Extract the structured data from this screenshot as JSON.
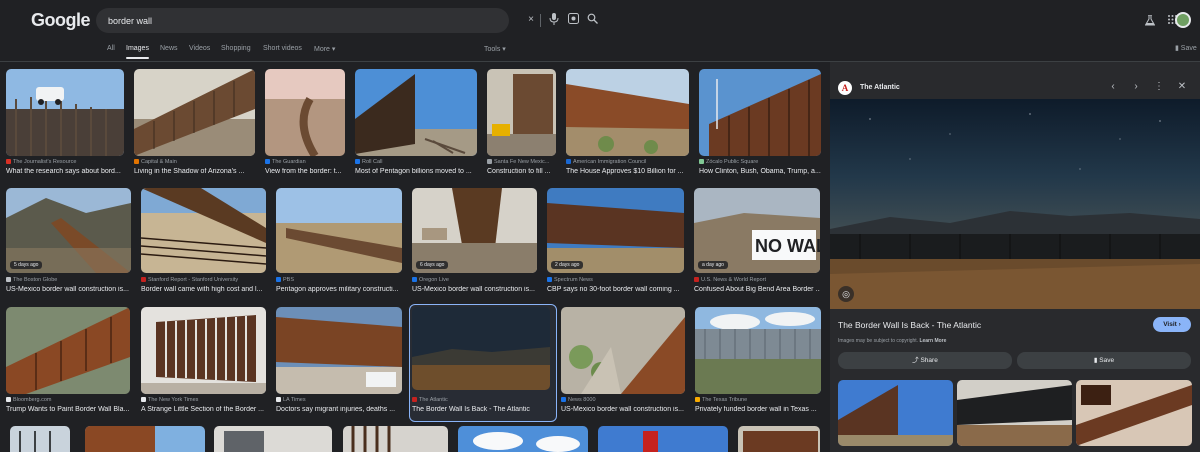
{
  "header": {
    "logo": "Google",
    "search_value": "border wall",
    "tabs": [
      "All",
      "Images",
      "News",
      "Videos",
      "Shopping",
      "Short videos",
      "More ▾",
      "Tools ▾"
    ],
    "save_label": "Save"
  },
  "icons": {
    "clear": "×",
    "mic": "🎤",
    "lens": "◎",
    "search": "⌕",
    "labs": "⚗",
    "apps": "⋮⋮",
    "bookmark": "▮"
  },
  "results": [
    {
      "source": "The Journalist's Resource",
      "title": "What the research says about bord...",
      "icon_color": "#d93025"
    },
    {
      "source": "Capital & Main",
      "title": "Living in the Shadow of Arizona's ...",
      "icon_color": "#e37400"
    },
    {
      "source": "The Guardian",
      "title": "View from the border: t...",
      "icon_color": "#1a73e8"
    },
    {
      "source": "Roll Call",
      "title": "Most of Pentagon billions moved to ...",
      "icon_color": "#1a73e8"
    },
    {
      "source": "Santa Fe New Mexic...",
      "title": "Construction to fill ...",
      "icon_color": "#9aa0a6"
    },
    {
      "source": "American Immigration Council",
      "title": "The House Approves $10 Billion for ...",
      "icon_color": "#1967d2"
    },
    {
      "source": "Zócalo Public Square",
      "title": "How Clinton, Bush, Obama, Trump, a...",
      "icon_color": "#81c995"
    },
    {
      "source": "The Boston Globe",
      "title": "US-Mexico border wall construction is...",
      "icon_color": "#bdc1c6",
      "badge": "5 days ago"
    },
    {
      "source": "Stanford Report - Stanford University",
      "title": "Border wall came with high cost and l...",
      "icon_color": "#c5221f"
    },
    {
      "source": "PBS",
      "title": "Pentagon approves military constructi...",
      "icon_color": "#1a73e8"
    },
    {
      "source": "Oregon Live",
      "title": "US-Mexico border wall construction is...",
      "icon_color": "#1a73e8",
      "badge": "6 days ago"
    },
    {
      "source": "Spectrum News",
      "title": "CBP says no 30-foot border wall coming ...",
      "icon_color": "#1a73e8",
      "badge": "2 days ago"
    },
    {
      "source": "U.S. News & World Report",
      "title": "Confused About Big Bend Area Border ...",
      "icon_color": "#c5221f",
      "badge": "a day ago"
    },
    {
      "source": "Bloomberg.com",
      "title": "Trump Wants to Paint Border Wall Bla...",
      "icon_color": "#e8eaed"
    },
    {
      "source": "The New York Times",
      "title": "A Strange Little Section of the Border ...",
      "icon_color": "#e8eaed"
    },
    {
      "source": "LA Times",
      "title": "Doctors say migrant injuries, deaths ...",
      "icon_color": "#e8eaed"
    },
    {
      "source": "The Atlantic",
      "title": "The Border Wall Is Back - The Atlantic",
      "icon_color": "#c5221f"
    },
    {
      "source": "News 8000",
      "title": "US-Mexico border wall construction is...",
      "icon_color": "#1a73e8"
    },
    {
      "source": "The Texas Tribune",
      "title": "Privately funded border wall in Texas ...",
      "icon_color": "#f9ab00"
    }
  ],
  "panel": {
    "source": "The Atlantic",
    "source_logo": "A",
    "title": "The Border Wall Is Back - The Atlantic",
    "visit_label": "Visit ›",
    "copyright": "Images may be subject to copyright.",
    "learn_more": "Learn More",
    "share_label": "Share",
    "save_label": "Save",
    "icons": {
      "prev": "‹",
      "next": "›",
      "more": "⋮",
      "close": "✕",
      "share": "⤴",
      "save": "▮",
      "lens": "◎"
    }
  }
}
